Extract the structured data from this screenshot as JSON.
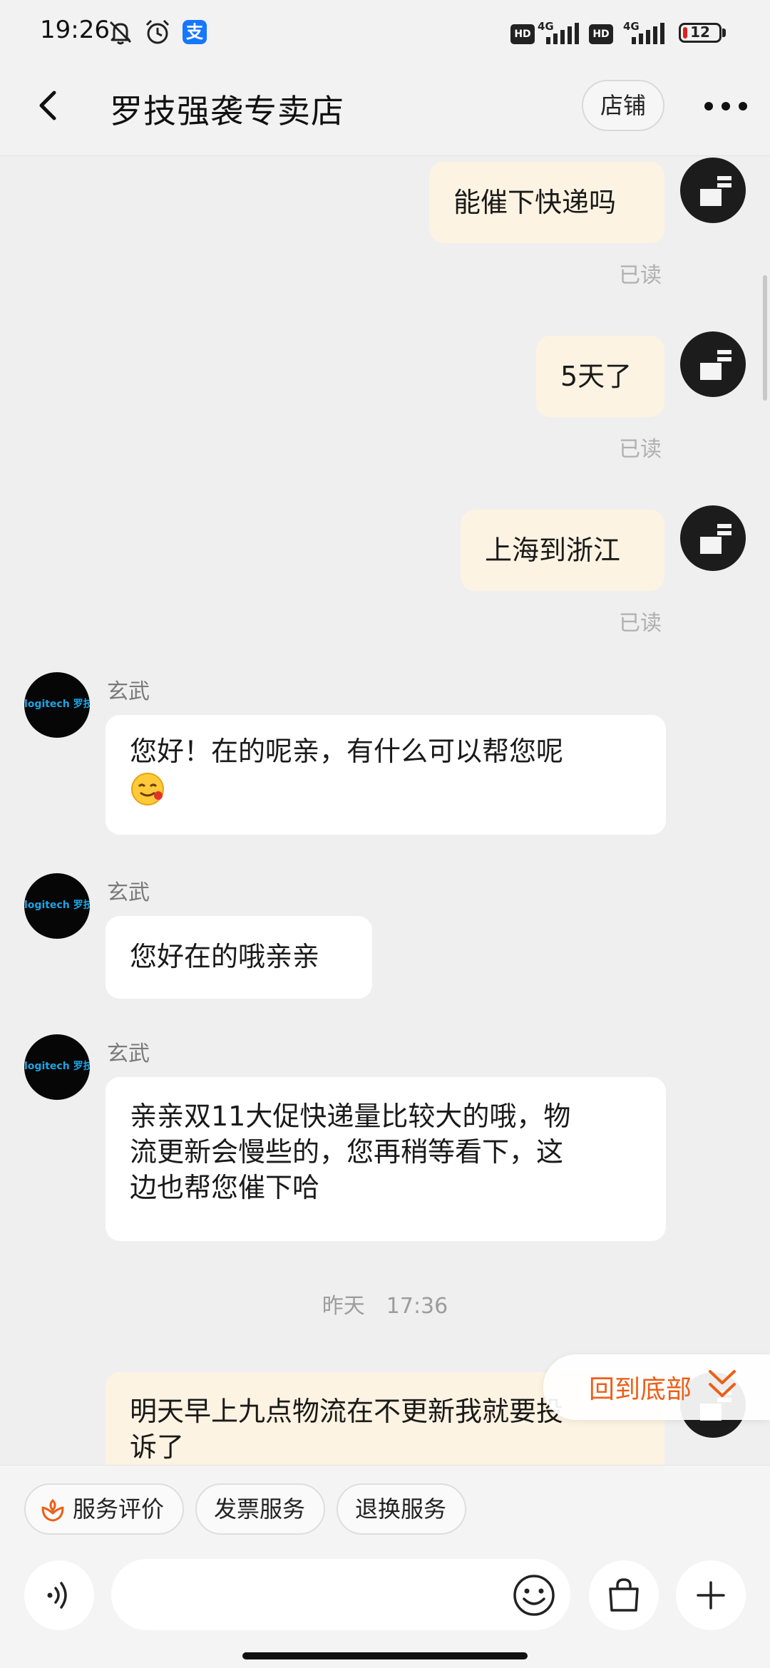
{
  "status_bar": {
    "time": "19:26",
    "icons": [
      "bell-off-icon",
      "alarm-icon",
      "alipay-icon"
    ],
    "hd_label": "HD",
    "network": "4G",
    "battery": "12",
    "battery_level": 0.12
  },
  "header": {
    "title": "罗技强袭专卖店",
    "store_button": "店铺"
  },
  "messages": [
    {
      "side": "out",
      "text": "能催下快递吗",
      "status": "已读"
    },
    {
      "side": "out",
      "text": "5天了",
      "status": "已读"
    },
    {
      "side": "out",
      "text": "上海到浙江",
      "status": "已读"
    },
    {
      "side": "in",
      "sender": "玄武",
      "avatar_text": "logitech 罗技",
      "text": "您好！在的呢亲，有什么可以帮您呢",
      "emoji": "smiling-face-icon"
    },
    {
      "side": "in",
      "sender": "玄武",
      "avatar_text": "logitech 罗技",
      "text": "您好在的哦亲亲"
    },
    {
      "side": "in",
      "sender": "玄武",
      "avatar_text": "logitech 罗技",
      "lines": [
        "亲亲双11大促快递量比较大的哦，物",
        "流更新会慢些的，您再稍等看下，这",
        "边也帮您催下哈"
      ]
    }
  ],
  "timestamp": "昨天　17:36",
  "last_message": {
    "side": "out",
    "lines": [
      "明天早上九点物流在不更新我就要投",
      "诉了"
    ]
  },
  "back_to_bottom": "回到底部",
  "quick_actions": [
    {
      "label": "服务评价",
      "icon": "service-rating-icon"
    },
    {
      "label": "发票服务"
    },
    {
      "label": "退换服务"
    }
  ],
  "input": {
    "placeholder": ""
  },
  "colors": {
    "outgoing_bubble": "#fdf3e2",
    "incoming_bubble": "#ffffff",
    "accent": "#ec5f17",
    "background": "#efefef"
  }
}
